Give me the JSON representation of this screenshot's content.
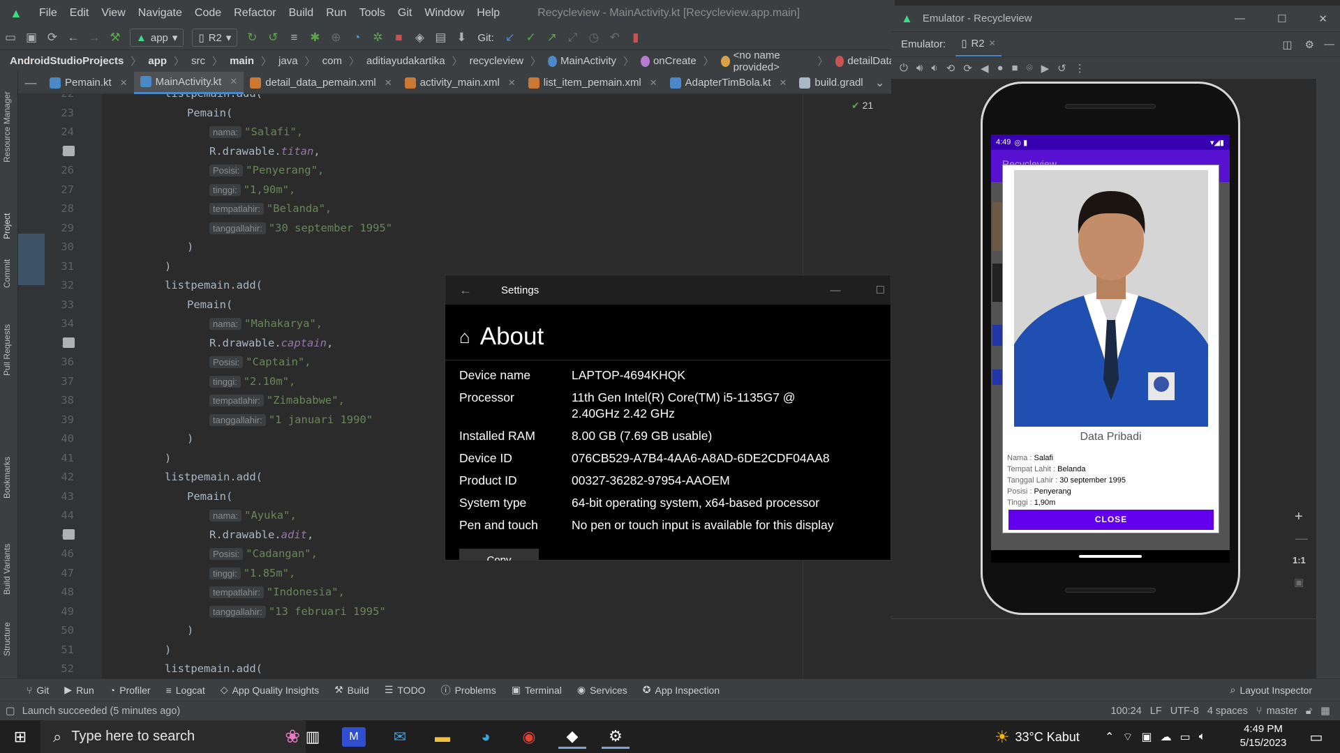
{
  "menubar": {
    "items": [
      "File",
      "Edit",
      "View",
      "Navigate",
      "Code",
      "Refactor",
      "Build",
      "Run",
      "Tools",
      "Git",
      "Window",
      "Help"
    ],
    "window_title": "Recycleview - MainActivity.kt [Recycleview.app.main]"
  },
  "toolbar": {
    "run_config": "app",
    "device": "R2",
    "git_label": "Git:"
  },
  "breadcrumb": {
    "items": [
      "AndroidStudioProjects",
      "app",
      "src",
      "main",
      "java",
      "com",
      "aditiayudakartika",
      "recycleview",
      "MainActivity",
      "onCreate",
      "<no name provided>",
      "detailData"
    ]
  },
  "tabs": [
    {
      "label": "Pemain.kt",
      "color": "#4a88c7"
    },
    {
      "label": "MainActivity.kt",
      "color": "#4a88c7"
    },
    {
      "label": "detail_data_pemain.xml",
      "color": "#cc7832"
    },
    {
      "label": "activity_main.xml",
      "color": "#cc7832"
    },
    {
      "label": "list_item_pemain.xml",
      "color": "#cc7832"
    },
    {
      "label": "AdapterTimBola.kt",
      "color": "#4a88c7"
    },
    {
      "label": "build.gradl",
      "color": "#a9b7c6"
    }
  ],
  "left_strip": {
    "tabs": [
      "Resource Manager",
      "Project",
      "Commit",
      "Pull Requests",
      "Bookmarks",
      "Build Variants",
      "Structure"
    ]
  },
  "editor": {
    "inspection_count": "21",
    "code_lines": [
      {
        "n": "22",
        "text": "listpemain.add("
      },
      {
        "n": "23",
        "text": "Pemain("
      },
      {
        "n": "24",
        "hint": "nama:",
        "value": "\"Salafi\","
      },
      {
        "n": "25",
        "text": "R.drawable.",
        "prop": "titan",
        "tail": ","
      },
      {
        "n": "26",
        "hint": "Posisi:",
        "value": "\"Penyerang\","
      },
      {
        "n": "27",
        "hint": "tinggi:",
        "value": "\"1,90m\","
      },
      {
        "n": "28",
        "hint": "tempatlahir:",
        "value": "\"Belanda\","
      },
      {
        "n": "29",
        "hint": "tanggallahir:",
        "value": "\"30 september 1995\""
      },
      {
        "n": "30",
        "text": ")"
      },
      {
        "n": "31",
        "text": ")"
      },
      {
        "n": "32",
        "text": "listpemain.add("
      },
      {
        "n": "33",
        "text": "Pemain("
      },
      {
        "n": "34",
        "hint": "nama:",
        "value": "\"Mahakarya\","
      },
      {
        "n": "35",
        "text": "R.drawable.",
        "prop": "captain",
        "tail": ","
      },
      {
        "n": "36",
        "hint": "Posisi:",
        "value": "\"Captain\","
      },
      {
        "n": "37",
        "hint": "tinggi:",
        "value": "\"2.10m\","
      },
      {
        "n": "38",
        "hint": "tempatlahir:",
        "value": "\"Zimababwe\","
      },
      {
        "n": "39",
        "hint": "tanggallahir:",
        "value": "\"1 januari 1990\""
      },
      {
        "n": "40",
        "text": ")"
      },
      {
        "n": "41",
        "text": ")"
      },
      {
        "n": "42",
        "text": "listpemain.add("
      },
      {
        "n": "43",
        "text": "Pemain("
      },
      {
        "n": "44",
        "hint": "nama:",
        "value": "\"Ayuka\","
      },
      {
        "n": "45",
        "text": "R.drawable.",
        "prop": "adit",
        "tail": ","
      },
      {
        "n": "46",
        "hint": "Posisi:",
        "value": "\"Cadangan\","
      },
      {
        "n": "47",
        "hint": "tinggi:",
        "value": "\"1.85m\","
      },
      {
        "n": "48",
        "hint": "tempatlahir:",
        "value": "\"Indonesia\","
      },
      {
        "n": "49",
        "hint": "tanggallahir:",
        "value": "\"13 februari 1995\""
      },
      {
        "n": "50",
        "text": ")"
      },
      {
        "n": "51",
        "text": ")"
      },
      {
        "n": "52",
        "text": "listpemain.add("
      }
    ]
  },
  "settings": {
    "title": "Settings",
    "heading": "About",
    "rows": [
      {
        "label": "Device name",
        "value": "LAPTOP-4694KHQK"
      },
      {
        "label": "Processor",
        "value": "11th Gen Intel(R) Core(TM) i5-1135G7 @ 2.40GHz 2.42 GHz"
      },
      {
        "label": "Installed RAM",
        "value": "8.00 GB (7.69 GB usable)"
      },
      {
        "label": "Device ID",
        "value": "076CB529-A7B4-4AA6-A8AD-6DE2CDF04AA8"
      },
      {
        "label": "Product ID",
        "value": "00327-36282-97954-AAOEM"
      },
      {
        "label": "System type",
        "value": "64-bit operating system, x64-based processor"
      },
      {
        "label": "Pen and touch",
        "value": "No pen or touch input is available for this display"
      }
    ],
    "copy_button": "Copy"
  },
  "emulator": {
    "title": "Emulator - Recycleview",
    "label": "Emulator:",
    "device_tab": "R2",
    "zoom_label": "1:1",
    "phone": {
      "time": "4:49",
      "app_title": "Recycleview",
      "dialog": {
        "heading": "Data Pribadi",
        "fields": [
          {
            "label": "Nama : ",
            "value": "Salafi"
          },
          {
            "label": "Tempat Lahit : ",
            "value": "Belanda"
          },
          {
            "label": "Tanggal Lahir : ",
            "value": "30 september 1995"
          },
          {
            "label": "Posisi : ",
            "value": "Penyerang"
          },
          {
            "label": "Tinggi : ",
            "value": "1,90m"
          }
        ],
        "close_button": "CLOSE"
      }
    }
  },
  "bottom_bar": {
    "items": [
      "Git",
      "Run",
      "Profiler",
      "Logcat",
      "App Quality Insights",
      "Build",
      "TODO",
      "Problems",
      "Terminal",
      "Services",
      "App Inspection"
    ],
    "layout_inspector": "Layout Inspector"
  },
  "status_bar": {
    "message": "Launch succeeded (5 minutes ago)",
    "position": "100:24",
    "line_sep": "LF",
    "encoding": "UTF-8",
    "indent": "4 spaces",
    "branch": "master"
  },
  "taskbar": {
    "search_placeholder": "Type here to search",
    "weather": "33°C  Kabut",
    "time": "4:49 PM",
    "date": "5/15/2023"
  }
}
